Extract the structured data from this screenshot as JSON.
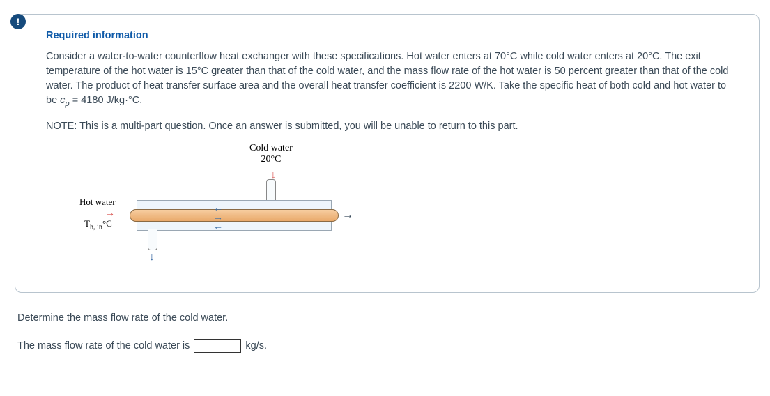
{
  "alert_glyph": "!",
  "info": {
    "heading": "Required information",
    "body_before_cp": "Consider a water-to-water counterflow heat exchanger with these specifications. Hot water enters at 70°C while cold water enters at 20°C. The exit temperature of the hot water is 15°C greater than that of the cold water, and the mass flow rate of the hot water is 50 percent greater than that of the cold water. The product of heat transfer surface area and the overall heat transfer coefficient is 2200 W/K. Take the specific heat of both cold and hot water to be ",
    "cp_var": "c",
    "cp_sub": "p",
    "cp_after": "= 4180 J/kg·°C.",
    "note": "NOTE: This is a multi-part question. Once an answer is submitted, you will be unable to return to this part."
  },
  "diagram": {
    "cold_label_l1": "Cold water",
    "cold_label_l2": "20°C",
    "hot_label": "Hot water",
    "thin_prefix": "T",
    "thin_sub": "h, in",
    "thin_unit": "°C",
    "arrow_down": "↓",
    "arrow_right": "→",
    "arrow_left": "←"
  },
  "question": {
    "prompt": "Determine the mass flow rate of the cold water.",
    "answer_prefix": "The mass flow rate of the cold water is",
    "answer_value": "",
    "unit": "kg/s."
  }
}
